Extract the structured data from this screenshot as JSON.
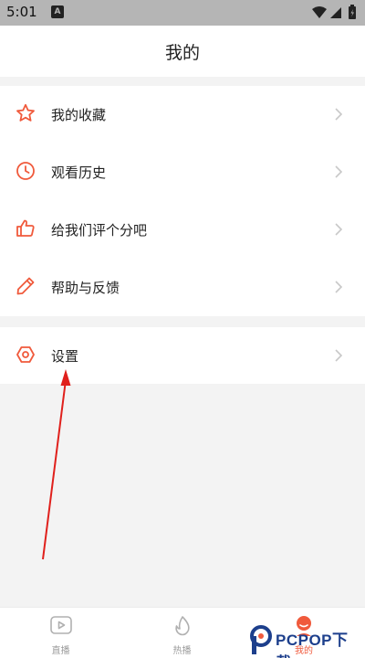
{
  "status_bar": {
    "time": "5:01",
    "notification_icon": "A"
  },
  "header": {
    "title": "我的"
  },
  "menu": {
    "group1": [
      {
        "label": "我的收藏",
        "icon": "star-icon"
      },
      {
        "label": "观看历史",
        "icon": "clock-icon"
      },
      {
        "label": "给我们评个分吧",
        "icon": "thumbs-up-icon"
      },
      {
        "label": "帮助与反馈",
        "icon": "pencil-icon"
      }
    ],
    "group2": [
      {
        "label": "设置",
        "icon": "settings-hexagon-icon"
      }
    ]
  },
  "tabbar": {
    "tabs": [
      {
        "label": "直播",
        "icon": "play-screen-icon",
        "active": false
      },
      {
        "label": "热播",
        "icon": "flame-icon",
        "active": false
      },
      {
        "label": "我的",
        "icon": "profile-icon",
        "active": true
      }
    ]
  },
  "watermark": {
    "text": "PCPOP下载"
  },
  "colors": {
    "accent": "#f05a3c",
    "annotation_arrow": "#e0201c",
    "status_bar": "#b5b5b5",
    "background": "#f3f3f3"
  }
}
